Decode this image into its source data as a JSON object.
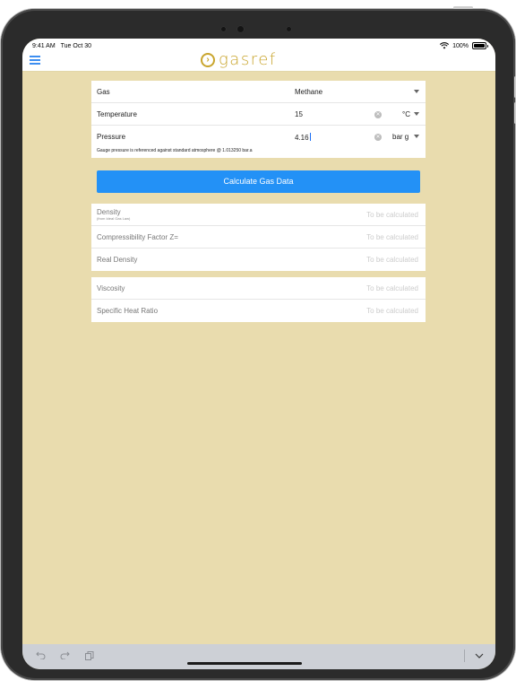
{
  "status_bar": {
    "time": "9:41 AM",
    "date": "Tue Oct 30",
    "battery": "100%"
  },
  "header": {
    "logo_text": "gasref"
  },
  "inputs": {
    "gas": {
      "label": "Gas",
      "value": "Methane"
    },
    "temperature": {
      "label": "Temperature",
      "value": "15",
      "unit": "°C"
    },
    "pressure": {
      "label": "Pressure",
      "value": "4.16",
      "unit": "bar g",
      "note": "Gauge pressure is referenced against standard atmosphere @ 1.013250 bar.a"
    }
  },
  "calculate_button": {
    "label": "Calculate Gas Data"
  },
  "results_group1": [
    {
      "label": "Density",
      "sub": "(from Ideal Gas Law)",
      "value": "To be calculated"
    },
    {
      "label": "Compressibility Factor Z=",
      "value": "To be calculated"
    },
    {
      "label": "Real Density",
      "value": "To be calculated"
    }
  ],
  "results_group2": [
    {
      "label": "Viscosity",
      "value": "To be calculated"
    },
    {
      "label": "Specific Heat Ratio",
      "value": "To be calculated"
    }
  ],
  "icons": {
    "menu": "hamburger-icon",
    "logo": "chevron-circle-icon",
    "undo": "undo-icon",
    "redo": "redo-icon",
    "paste": "clipboard-icon",
    "dismiss_keyboard": "chevron-down-icon"
  },
  "colors": {
    "background": "#e9dcae",
    "accent": "#2391f6",
    "logo": "#c9a52d"
  }
}
